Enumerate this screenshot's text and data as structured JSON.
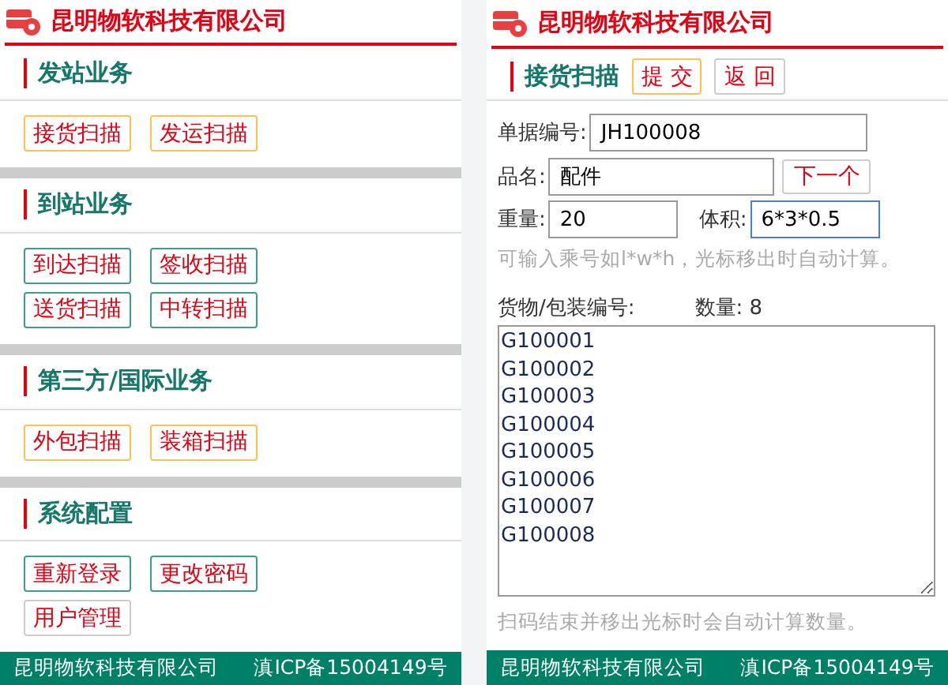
{
  "left_screen": {
    "header": {
      "title": "昆明物软科技有限公司"
    },
    "sections": [
      {
        "heading": "发站业务",
        "buttons": [
          {
            "label": "接货扫描",
            "kind": "accent"
          },
          {
            "label": "发运扫描",
            "kind": "accent"
          }
        ]
      },
      {
        "heading": "到站业务",
        "buttons": [
          {
            "label": "到达扫描",
            "kind": "normal"
          },
          {
            "label": "签收扫描",
            "kind": "normal"
          },
          {
            "label": "送货扫描",
            "kind": "normal"
          },
          {
            "label": "中转扫描",
            "kind": "normal"
          }
        ]
      },
      {
        "heading": "第三方/国际业务",
        "buttons": [
          {
            "label": "外包扫描",
            "kind": "accent"
          },
          {
            "label": "装箱扫描",
            "kind": "accent"
          }
        ]
      },
      {
        "heading": "系统配置",
        "buttons": [
          {
            "label": "重新登录",
            "kind": "normal"
          },
          {
            "label": "更改密码",
            "kind": "normal"
          },
          {
            "label": "用户管理",
            "kind": "plain"
          }
        ]
      }
    ],
    "footer": {
      "company": "昆明物软科技有限公司",
      "icp": "滇ICP备15004149号"
    }
  },
  "right_screen": {
    "header": {
      "title": "昆明物软科技有限公司"
    },
    "page_title": "接货扫描",
    "actions": [
      {
        "label": "提 交",
        "kind": "accent"
      },
      {
        "label": "返 回",
        "kind": "plain"
      }
    ],
    "doc_number": {
      "label": "单据编号:",
      "value": "JH100008",
      "focused": false
    },
    "item_name": {
      "label": "品名:",
      "value": "配件",
      "focused": false
    },
    "next_button": "下一个",
    "weight": {
      "label": "重量:",
      "value": "20",
      "focused": false
    },
    "volume": {
      "label": "体积:",
      "value": "6*3*0.5",
      "focused": true
    },
    "volume_hint": "可输入乘号如l*w*h，光标移出时自动计算。",
    "codes_label": "货物/包装编号:",
    "count": "数量: 8",
    "codes": [
      "G100001",
      "G100002",
      "G100003",
      "G100004",
      "G100005",
      "G100006",
      "G100007",
      "G100008"
    ],
    "codes_hint": "扫码结束并移出光标时会自动计算数量。",
    "footer": {
      "company": "昆明物软科技有限公司",
      "icp": "滇ICP备15004149号"
    }
  }
}
